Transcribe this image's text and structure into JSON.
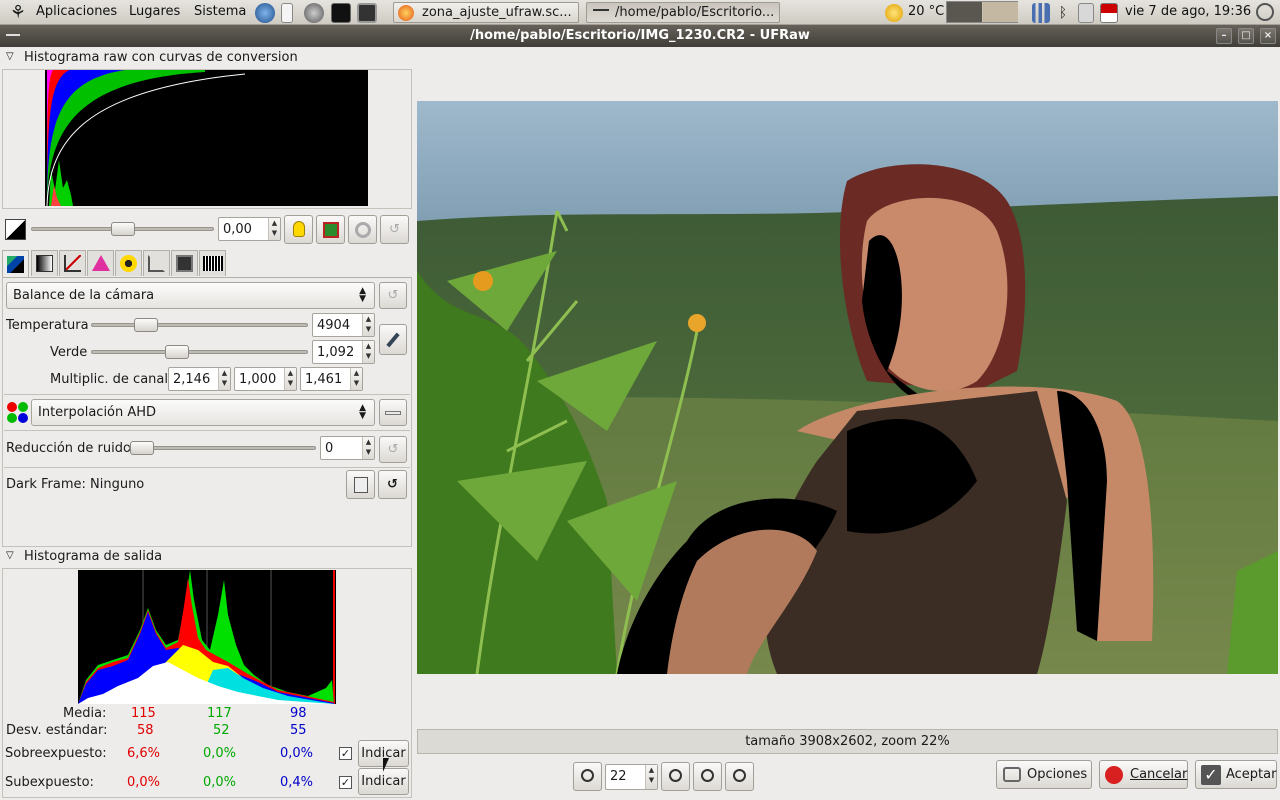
{
  "panel": {
    "menu": [
      "Aplicaciones",
      "Lugares",
      "Sistema"
    ],
    "tasks": [
      "zona_ajuste_ufraw.sc...",
      "/home/pablo/Escritorio..."
    ],
    "weather": "20 °C",
    "clock": "vie  7 de ago, 19:36"
  },
  "window": {
    "title": "/home/pablo/Escritorio/IMG_1230.CR2 - UFRaw"
  },
  "raw_histogram": {
    "title": "Histograma raw con curvas de conversion"
  },
  "exposure": {
    "value": "0,00",
    "slider_fraction": 0.5
  },
  "white_balance": {
    "combo": "Balance de la cámara",
    "temperature_label": "Temperatura",
    "temperature": "4904",
    "green_label": "Verde",
    "green": "1,092",
    "channel_label": "Multiplic. de canal:",
    "channels": [
      "2,146",
      "1,000",
      "1,461"
    ]
  },
  "interpolation": {
    "combo": "Interpolación AHD"
  },
  "noise": {
    "label": "Reducción de ruido",
    "value": "0"
  },
  "dark_frame": {
    "label": "Dark Frame: Ninguno"
  },
  "output_histogram": {
    "title": "Histograma de salida",
    "rows": [
      {
        "label": "Media:",
        "r": "115",
        "g": "117",
        "b": "98"
      },
      {
        "label": "Desv. estándar:",
        "r": "58",
        "g": "52",
        "b": "55"
      },
      {
        "label": "Sobreexpuesto:",
        "r": "6,6%",
        "g": "0,0%",
        "b": "0,0%",
        "button": "Indicar"
      },
      {
        "label": "Subexpuesto:",
        "r": "0,0%",
        "g": "0,0%",
        "b": "0,4%",
        "button": "Indicar"
      }
    ]
  },
  "preview": {
    "status": "tamaño 3908x2602, zoom 22%",
    "zoom": "22"
  },
  "actions": {
    "options": "Opciones",
    "cancel": "Cancelar",
    "accept": "Aceptar"
  }
}
